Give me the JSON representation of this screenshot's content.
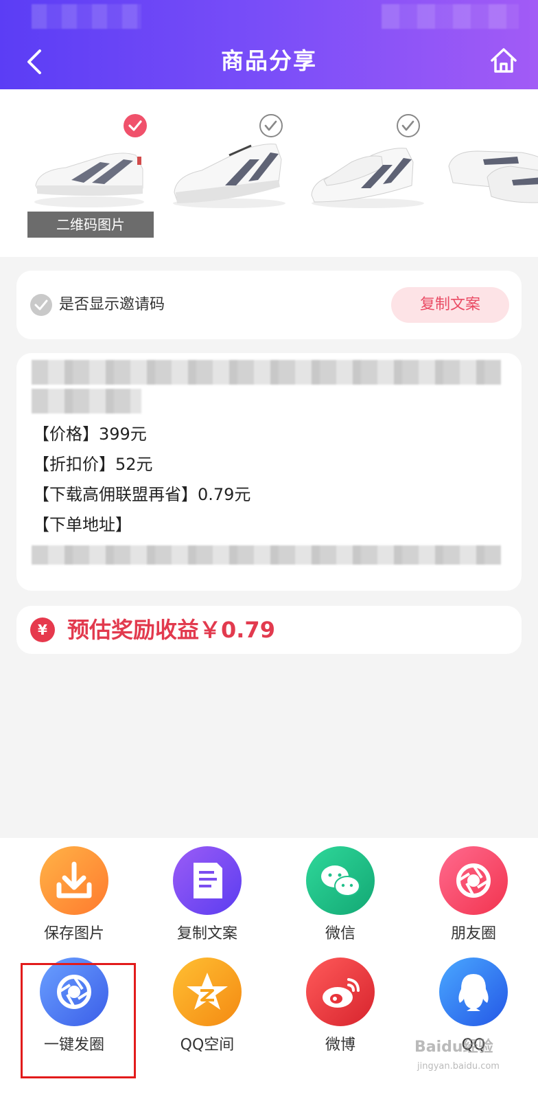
{
  "header": {
    "title": "商品分享",
    "back_icon": "back-arrow-icon",
    "home_icon": "home-icon"
  },
  "gallery": {
    "selected_index": 0,
    "qr_label": "二维码图片",
    "check_colors": {
      "selected": "#f0516b",
      "unselected": "#888888"
    }
  },
  "invite": {
    "label": "是否显示邀请码",
    "copy_button": "复制文案"
  },
  "copy_text": {
    "lines": [
      "【价格】399元",
      "【折扣价】52元",
      "【下载高佣联盟再省】0.79元",
      "【下单地址】"
    ]
  },
  "reward": {
    "icon": "¥",
    "text": "预估奖励收益￥0.79"
  },
  "share": {
    "items": [
      {
        "label": "保存图片",
        "icon": "download-icon",
        "color": "#ff9a3c"
      },
      {
        "label": "复制文案",
        "icon": "document-icon",
        "color": "#7b4df0"
      },
      {
        "label": "微信",
        "icon": "wechat-icon",
        "color": "#20c08a"
      },
      {
        "label": "朋友圈",
        "icon": "moments-icon",
        "color": "#f5456e"
      },
      {
        "label": "一键发圈",
        "icon": "shutter-icon",
        "color": "#4f7df0"
      },
      {
        "label": "QQ空间",
        "icon": "qzone-icon",
        "color": "#f7a21b"
      },
      {
        "label": "微博",
        "icon": "weibo-icon",
        "color": "#e8343b"
      },
      {
        "label": "QQ",
        "icon": "qq-icon",
        "color": "#3573f0"
      }
    ]
  },
  "watermark": {
    "text": "Baidu经验",
    "sub": "jingyan.baidu.com"
  }
}
